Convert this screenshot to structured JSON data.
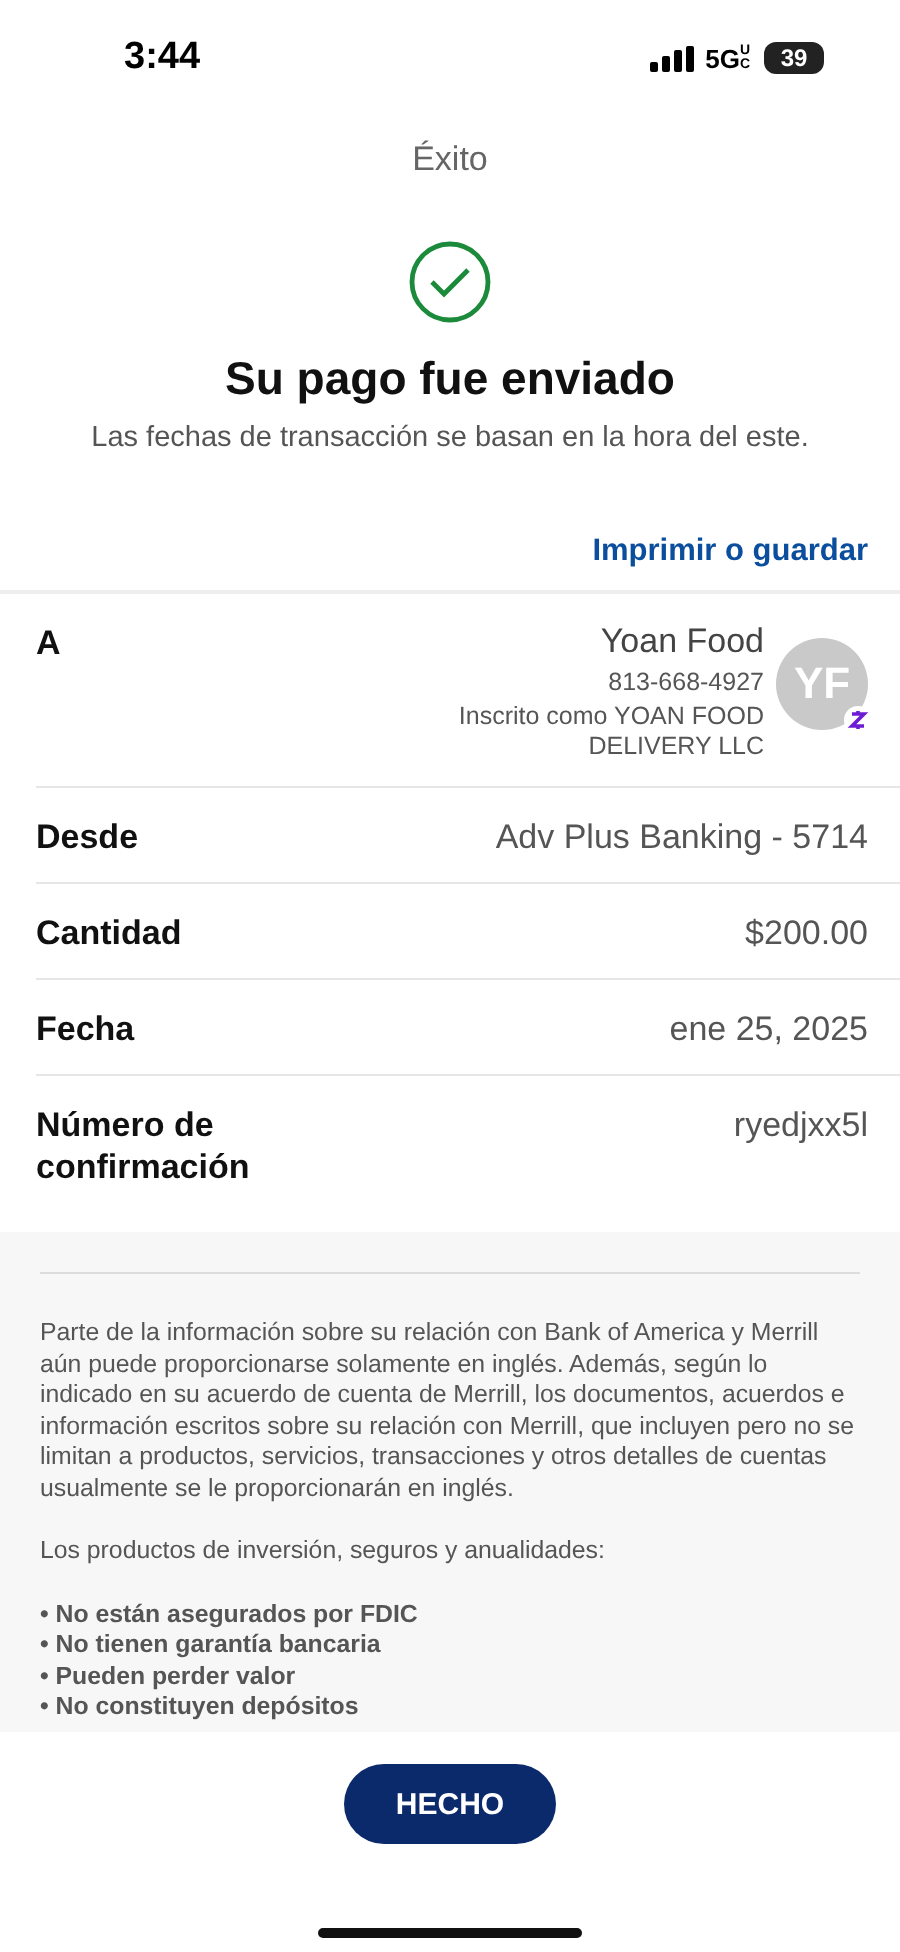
{
  "status_bar": {
    "time": "3:44",
    "network": "5G",
    "network_sub": "UC",
    "battery": "39"
  },
  "title": "Éxito",
  "heading": "Su pago fue enviado",
  "subtitle": "Las fechas de transacción se basan en la hora del este.",
  "print_link": "Imprimir o guardar",
  "recipient": {
    "label": "A",
    "name": "Yoan Food",
    "phone": "813-668-4927",
    "enrolled": "Inscrito como YOAN FOOD DELIVERY LLC",
    "initials": "YF"
  },
  "details": [
    {
      "label": "Desde",
      "value": "Adv Plus Banking - 5714"
    },
    {
      "label": "Cantidad",
      "value": "$200.00"
    },
    {
      "label": "Fecha",
      "value": "ene 25, 2025"
    },
    {
      "label": "Número de confirmación",
      "value": "ryedjxx5l"
    }
  ],
  "disclaimer": [
    "Parte de la información sobre su relación con Bank of America y Merrill aún puede proporcionarse solamente en inglés. Además, según lo indicado en su acuerdo de cuenta de Merrill, los documentos, acuerdos e información escritos sobre su relación con Merrill, que incluyen pero no se limitan a productos, servicios, transacciones y otros detalles de cuentas usualmente se le proporcionarán en inglés.",
    "Los productos de inversión, seguros y anualidades:"
  ],
  "bullets": [
    "• No están asegurados por FDIC",
    "• No tienen garantía bancaria",
    "• Pueden perder valor",
    "• No constituyen depósitos"
  ],
  "done_button": "HECHO"
}
